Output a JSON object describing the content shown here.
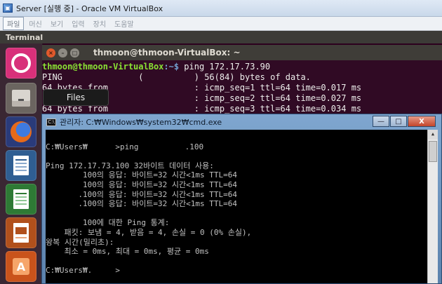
{
  "vbox": {
    "title": "Server [실행 중] - Oracle VM VirtualBox",
    "menu": [
      "파일",
      "머신",
      "보기",
      "입력",
      "장치",
      "도움말"
    ]
  },
  "ubuntu": {
    "panel_title": "Terminal",
    "tooltip": "Files"
  },
  "terminal": {
    "title": "thmoon@thmoon-VirtualBox: ~",
    "prompt_user": "thmoon@thmoon-VirtualBox",
    "prompt_path": ":~$",
    "command": " ping 172.17.73.90",
    "lines": [
      "PING               (          ) 56(84) bytes of data.",
      "64 bytes from                 : icmp_seq=1 ttl=64 time=0.017 ms",
      "                              : icmp_seq=2 ttl=64 time=0.027 ms",
      "64 bytes from                 : icmp_seq=3 ttl=64 time=0.034 ms"
    ]
  },
  "cmd": {
    "title": "관리자: C:₩Windows₩system32₩cmd.exe",
    "buttons": {
      "minimize": "—",
      "maximize": "□",
      "close": "X"
    },
    "lines": [
      "",
      "C:₩Users₩      >ping          .100",
      "",
      "Ping 172.17.73.100 32바이트 데이터 사용:",
      "        100의 응답: 바이트=32 시간<1ms TTL=64",
      "        100의 응답: 바이트=32 시간<1ms TTL=64",
      "       .100의 응답: 바이트=32 시간<1ms TTL=64",
      "       .100의 응답: 바이트=32 시간<1ms TTL=64",
      "",
      "        100에 대한 Ping 통계:",
      "    패킷: 보냄 = 4, 받음 = 4, 손실 = 0 (0% 손실),",
      "왕복 시간(밀리초):",
      "    최소 = 0ms, 최대 = 0ms, 평균 = 0ms",
      "",
      "C:₩Users₩.     >"
    ]
  }
}
